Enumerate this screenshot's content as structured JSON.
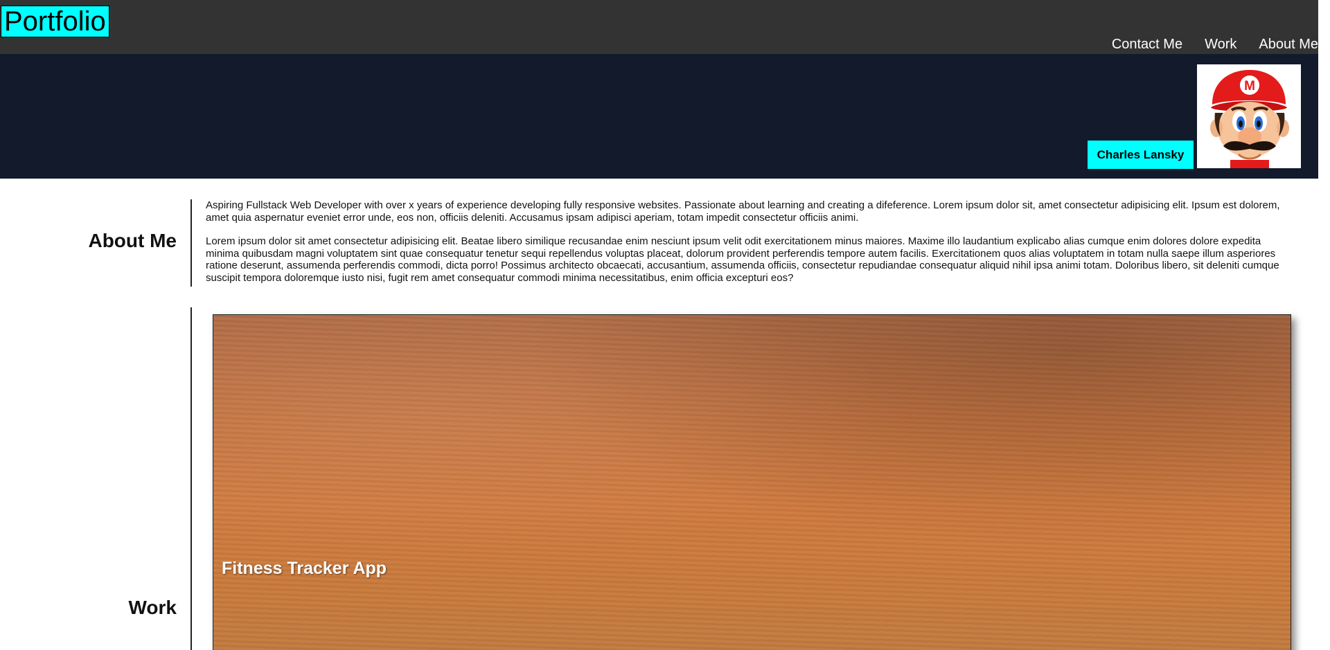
{
  "header": {
    "logo": "Portfolio",
    "nav": [
      "Contact Me",
      "Work",
      "About Me"
    ]
  },
  "hero": {
    "name": "Charles Lansky",
    "avatar_icon": "mario-avatar"
  },
  "about": {
    "title": "About Me",
    "paragraphs": [
      "Aspiring Fullstack Web Developer with over x years of experience developing fully responsive websites. Passionate about learning and creating a difeference. Lorem ipsum dolor sit, amet consectetur adipisicing elit. Ipsum est dolorem, amet quia aspernatur eveniet error unde, eos non, officiis deleniti. Accusamus ipsam adipisci aperiam, totam impedit consectetur officiis animi.",
      "Lorem ipsum dolor sit amet consectetur adipisicing elit. Beatae libero similique recusandae enim nesciunt ipsum velit odit exercitationem minus maiores. Maxime illo laudantium explicabo alias cumque enim dolores dolore expedita minima quibusdam magni voluptatem sint quae consequatur tenetur sequi repellendus voluptas placeat, dolorum provident perferendis tempore autem facilis. Exercitationem quos alias voluptatem in totam nulla saepe illum asperiores ratione deserunt, assumenda perferendis commodi, dicta porro! Possimus architecto obcaecati, accusantium, assumenda officiis, consectetur repudiandae consequatur aliquid nihil ipsa animi totam. Doloribus libero, sit deleniti cumque suscipit tempora doloremque iusto nisi, fugit rem amet consequatur commodi minima necessitatibus, enim officia excepturi eos?"
    ]
  },
  "work": {
    "title": "Work",
    "projects": [
      {
        "title": "Fitness Tracker App"
      }
    ]
  },
  "colors": {
    "topbar": "#333333",
    "hero": "#121a2c",
    "accent": "#00ffff"
  }
}
